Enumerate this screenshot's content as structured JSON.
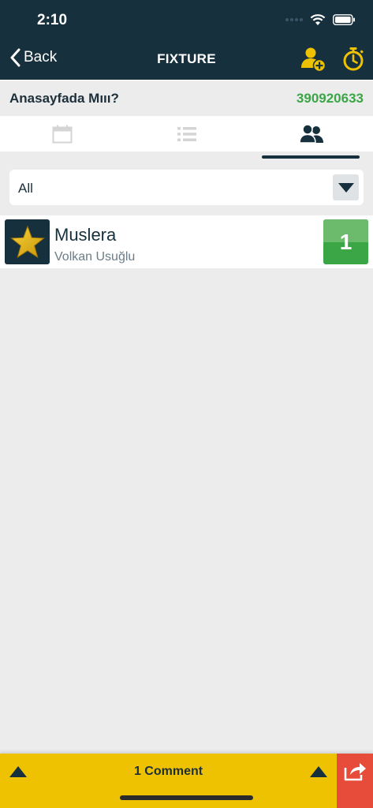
{
  "status": {
    "time": "2:10"
  },
  "nav": {
    "back_label": "Back",
    "title": "FIXTURE",
    "icons": [
      "add-user-icon",
      "stopwatch-icon"
    ]
  },
  "info": {
    "title": "Anasayfada Mııı?",
    "id": "390920633"
  },
  "tabs": [
    {
      "icon": "calendar-icon",
      "active": false
    },
    {
      "icon": "list-icon",
      "active": false
    },
    {
      "icon": "users-icon",
      "active": true
    }
  ],
  "filter": {
    "selected": "All"
  },
  "list": [
    {
      "title": "Muslera",
      "subtitle": "Volkan Usuğlu",
      "badge": "1",
      "avatar": "star-icon"
    }
  ],
  "footer": {
    "comment_label": "1 Comment"
  },
  "colors": {
    "navy": "#16303d",
    "accent_yellow": "#eec200",
    "green": "#3aa646",
    "share_red": "#e74b3a"
  }
}
